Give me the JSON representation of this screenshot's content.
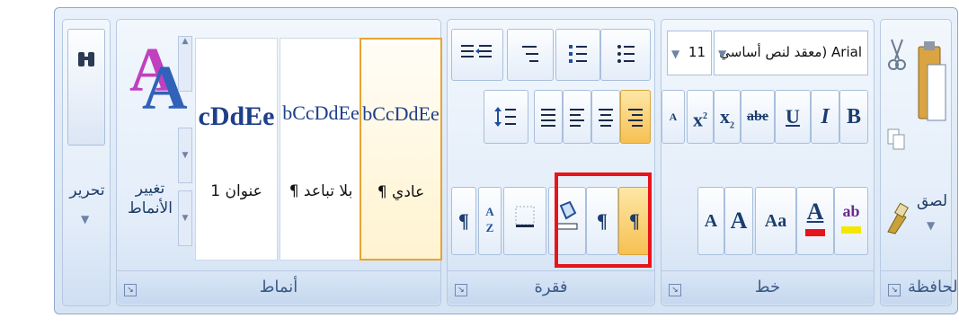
{
  "groups": {
    "editing": {
      "label": "تحرير"
    },
    "styles": {
      "label": "أنماط",
      "change_label": "تغيير الأنماط"
    },
    "paragraph": {
      "label": "فقرة"
    },
    "font": {
      "label": "خط"
    },
    "clipboard": {
      "label": "الحافظة"
    }
  },
  "clipboard": {
    "paste_label": "لصق"
  },
  "font": {
    "name": "معقد لنص أساسي) Arial",
    "size": "11",
    "bold": "B",
    "italic": "I",
    "underline": "U",
    "strike": "abe",
    "subscript": "x",
    "superscript": "x",
    "case_label": "Aa",
    "grow": "A",
    "shrink": "A",
    "font_color_letter": "A",
    "highlight_label": "ab",
    "clear_label": "A"
  },
  "styles": {
    "items": [
      {
        "sample": "bCcDdEe",
        "name": "¶ عادي",
        "selected": true
      },
      {
        "sample": "bCcDdEe",
        "name": "¶ بلا تباعد",
        "selected": false
      },
      {
        "sample": "cDdEe",
        "name": "عنوان 1",
        "selected": false
      }
    ]
  },
  "paragraph": {
    "sort_label": "A Z",
    "pilcrow": "¶"
  },
  "colors": {
    "accent": "#e8141b",
    "font_color": "#e8141b",
    "highlight": "#f5e800",
    "active": "#f7c052"
  }
}
